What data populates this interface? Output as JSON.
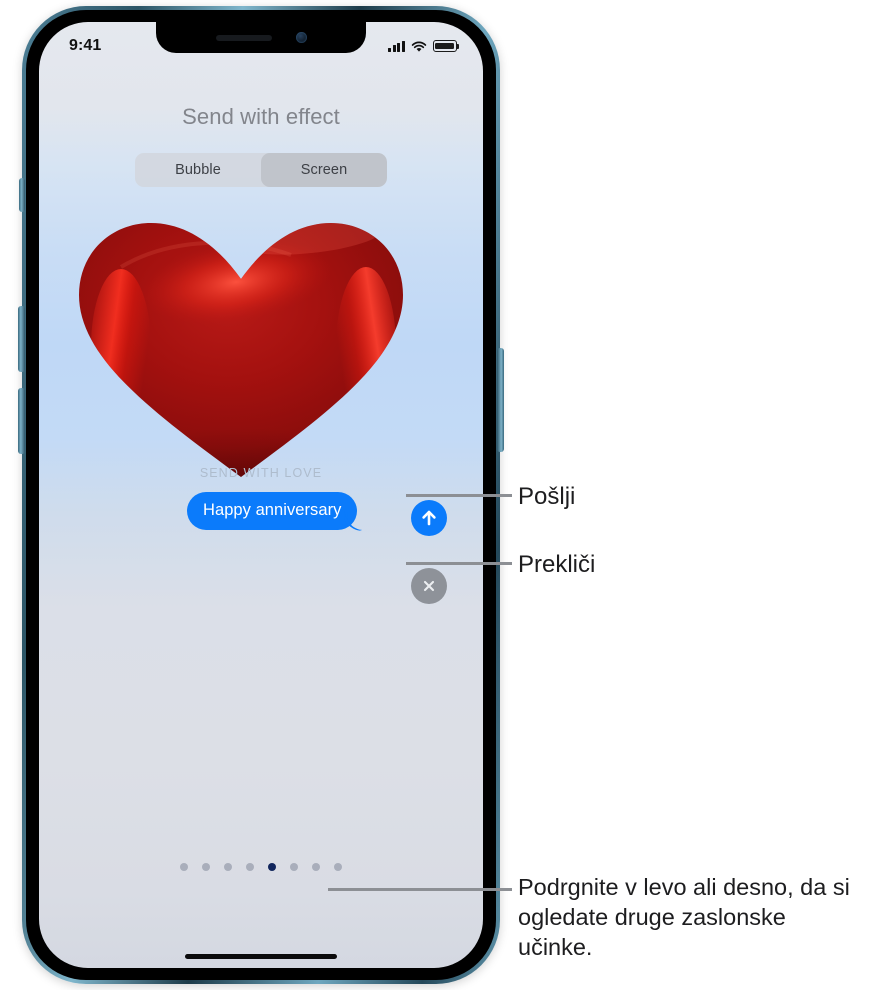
{
  "status_bar": {
    "time": "9:41",
    "cellular_icon": "signal-bars-icon",
    "wifi_icon": "wifi-icon",
    "battery_icon": "battery-icon"
  },
  "sheet": {
    "title": "Send with effect",
    "segmented_control": {
      "options": [
        {
          "label": "Bubble",
          "selected": false
        },
        {
          "label": "Screen",
          "selected": true
        }
      ]
    },
    "effect": {
      "name": "SEND WITH LOVE",
      "graphic": "red-heart-balloon"
    },
    "message": {
      "text": "Happy anniversary"
    },
    "send_button": {
      "icon": "arrow-up-icon",
      "color": "#0b7bfb"
    },
    "cancel_button": {
      "icon": "close-x-icon",
      "color": "#8e9299"
    },
    "page_dots": {
      "total": 8,
      "active_index": 4,
      "active_color": "#11255c",
      "inactive_color": "#a9aebb"
    }
  },
  "callouts": {
    "send": "Pošlji",
    "cancel": "Prekliči",
    "swipe": "Podrgnite v levo ali desno, da si ogledate druge zaslonske učinke."
  }
}
